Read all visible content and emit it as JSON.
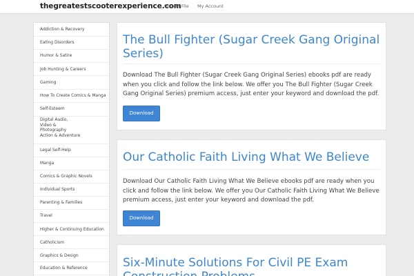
{
  "header": {
    "site_name": "thegreatestscooterexperience.com",
    "nav": [
      "Upload File",
      "My Account"
    ]
  },
  "sidebar": {
    "items": [
      "Addiction & Recovery",
      "Eating Disorders",
      "Humor & Satire",
      "Job Hunting & Careers",
      "Gaming",
      "How To Create Comics & Manga",
      "Self-Esteem",
      "Digital Audio, Video & Photography",
      "Action & Adventure",
      "Legal Self-Help",
      "Manga",
      "Comics & Graphic Novels",
      "Individual Sports",
      "Parenting & Families",
      "Travel",
      "Higher & Continuing Education",
      "Catholicism",
      "Graphics & Design",
      "Education & Reference"
    ]
  },
  "posts": [
    {
      "title": "The Bull Fighter (Sugar Creek Gang Original Series)",
      "text": "Download The Bull Fighter (Sugar Creek Gang Original Series) ebooks pdf are ready when you click and follow the link below. We offer you The Bull Fighter (Sugar Creek Gang Original Series) premium access, just enter your keyword and download the pdf.",
      "button": "Download"
    },
    {
      "title": "Our Catholic Faith Living What We Believe",
      "text": "Download Our Catholic Faith Living What We Believe ebooks pdf are ready when you click and follow the link below. We offer you Our Catholic Faith Living What We Believe premium access, just enter your keyword and download the pdf.",
      "button": "Download"
    },
    {
      "title": "Six-Minute Solutions For Civil PE Exam Construction Problems"
    }
  ],
  "colors": {
    "title": "#3d86d0",
    "button": "#3f85d4",
    "background": "#ececec"
  }
}
